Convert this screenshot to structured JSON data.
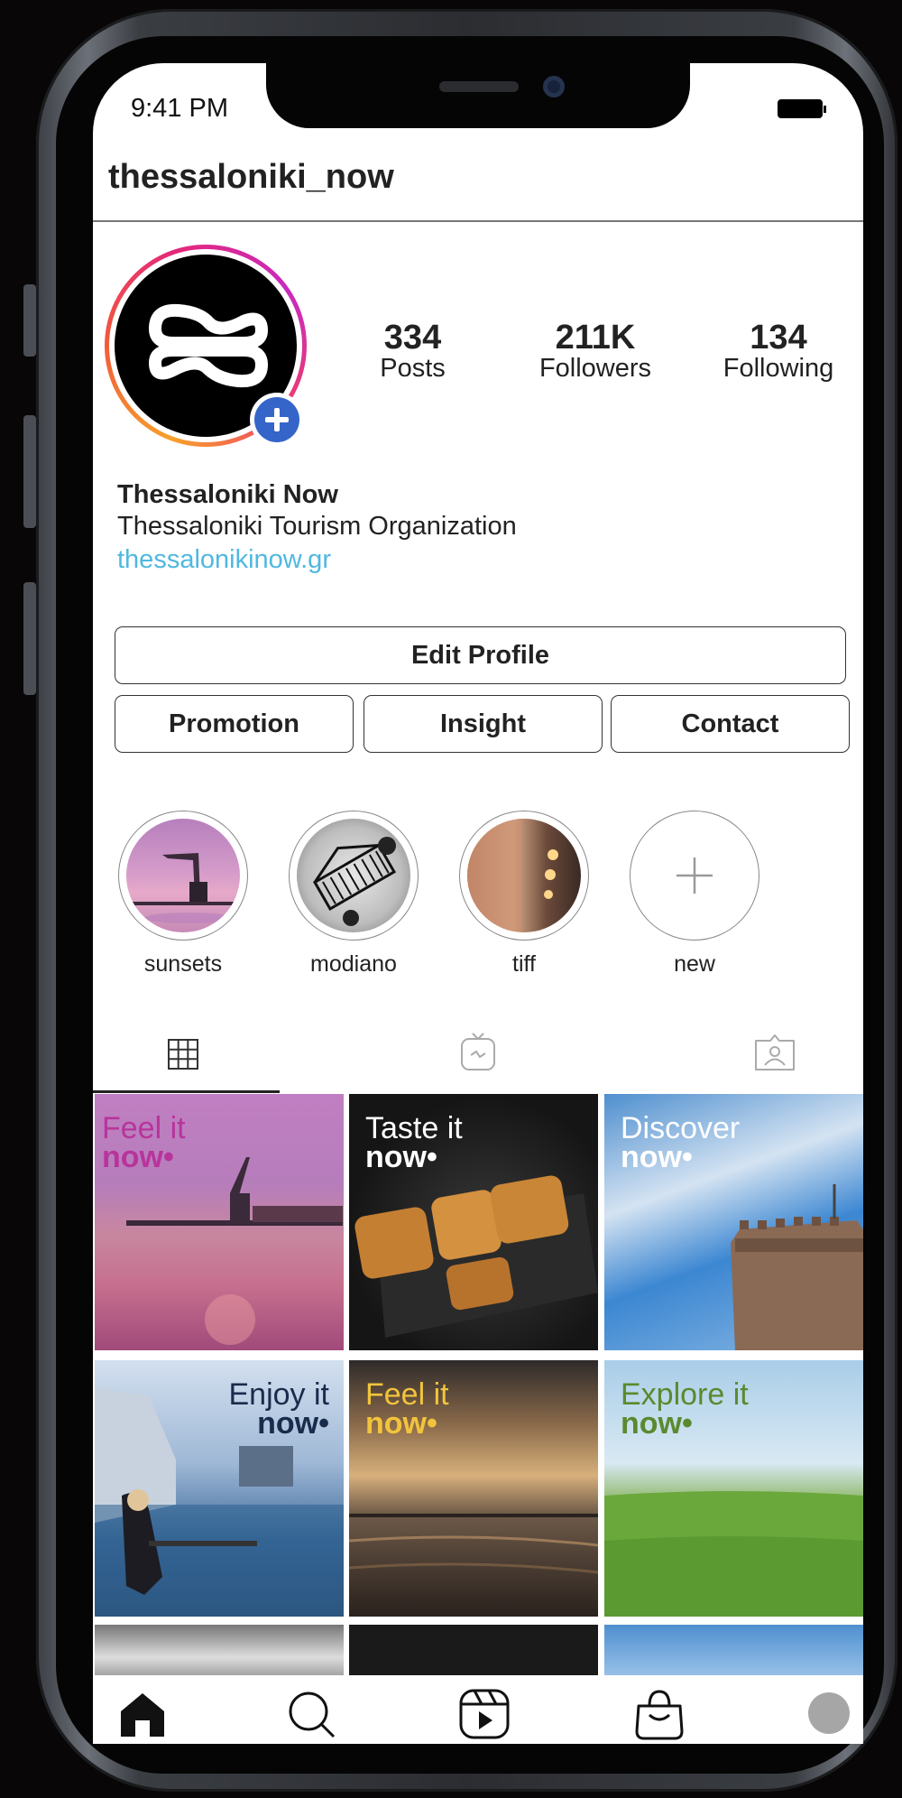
{
  "status": {
    "time": "9:41 PM"
  },
  "profile": {
    "username": "thessaloniki_now",
    "stats": [
      {
        "value": "334",
        "label": "Posts"
      },
      {
        "value": "211K",
        "label": "Followers"
      },
      {
        "value": "134",
        "label": "Following"
      }
    ],
    "display_name": "Thessaloniki Now",
    "bio": "Thessaloniki Tourism Organization",
    "link": "thessalonikinow.gr"
  },
  "buttons": {
    "edit_profile": "Edit Profile",
    "promotion": "Promotion",
    "insight": "Insight",
    "contact": "Contact"
  },
  "highlights": [
    {
      "label": "sunsets"
    },
    {
      "label": "modiano"
    },
    {
      "label": "tiff"
    },
    {
      "label": "new"
    }
  ],
  "tabs": [
    {
      "icon": "grid-icon",
      "selected": true
    },
    {
      "icon": "tv-icon",
      "selected": false
    },
    {
      "icon": "tagged-icon",
      "selected": false
    }
  ],
  "posts": [
    {
      "line1": "Feel it",
      "line2": "now•",
      "color": "#b8349b"
    },
    {
      "line1": "Taste it",
      "line2": "now•",
      "color": "#ffffff"
    },
    {
      "line1": "Discover",
      "line2": "now•",
      "color": "#ffffff"
    },
    {
      "line1": "Enjoy it",
      "line2": "now•",
      "color": "#1a2b4c"
    },
    {
      "line1": "Feel it",
      "line2": "now•",
      "color": "#f2c43c"
    },
    {
      "line1": "Explore it",
      "line2": "now•",
      "color": "#5a8a2e"
    }
  ],
  "bottom_nav": [
    "home-icon",
    "search-icon",
    "reels-icon",
    "shop-icon",
    "profile-avatar"
  ]
}
